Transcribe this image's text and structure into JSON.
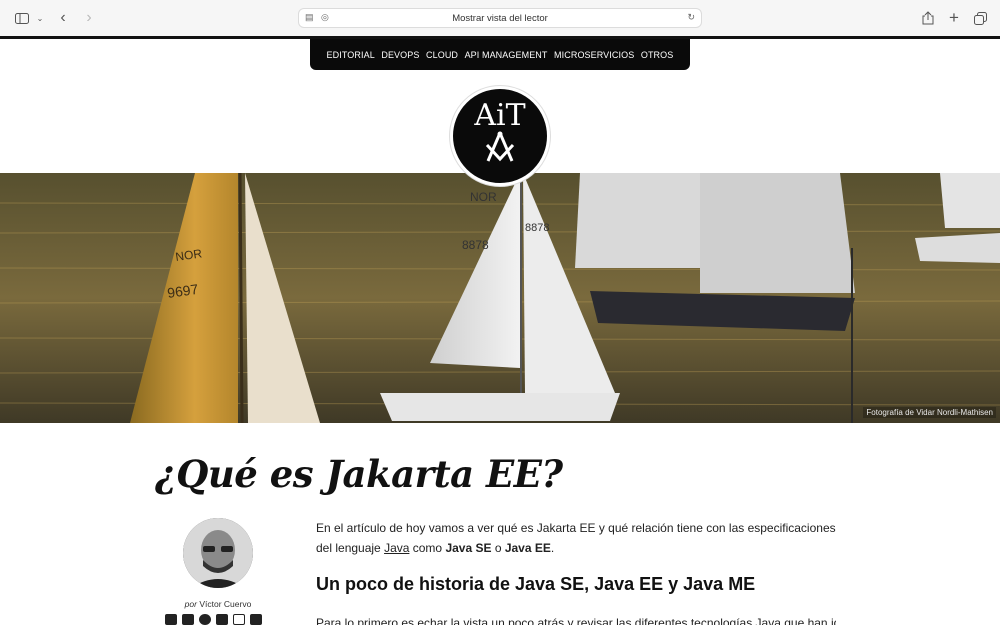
{
  "browser": {
    "url_text": "Mostrar vista del lector"
  },
  "nav": {
    "items": [
      "EDITORIAL",
      "DEVOPS",
      "CLOUD",
      "API MANAGEMENT",
      "MICROSERVICIOS",
      "OTROS"
    ]
  },
  "logo": {
    "text": "AiT"
  },
  "hero": {
    "caption": "Fotografía de Vidar Nordli-Mathisen",
    "sail_numbers": [
      "NOR",
      "9697",
      "NOR",
      "8878",
      "8878"
    ]
  },
  "article": {
    "title": "¿Qué es Jakarta EE?",
    "byline_prefix": "por",
    "author": "Víctor Cuervo",
    "intro_1": "En el artículo de hoy vamos a ver qué es Jakarta EE y qué relación tiene con las especificaciones del lenguaje ",
    "intro_link": "Java",
    "intro_2": " como ",
    "intro_b1": "Java SE",
    "intro_3": " o ",
    "intro_b2": "Java EE",
    "intro_4": ".",
    "heading": "Un poco de historia de Java SE, Java EE y Java ME",
    "p2": "Para lo primero es echar la vista un poco atrás y revisar las diferentes tecnologías Java que han ido"
  },
  "colors": {
    "nav_bg": "#0a0a0a",
    "text": "#111111"
  }
}
